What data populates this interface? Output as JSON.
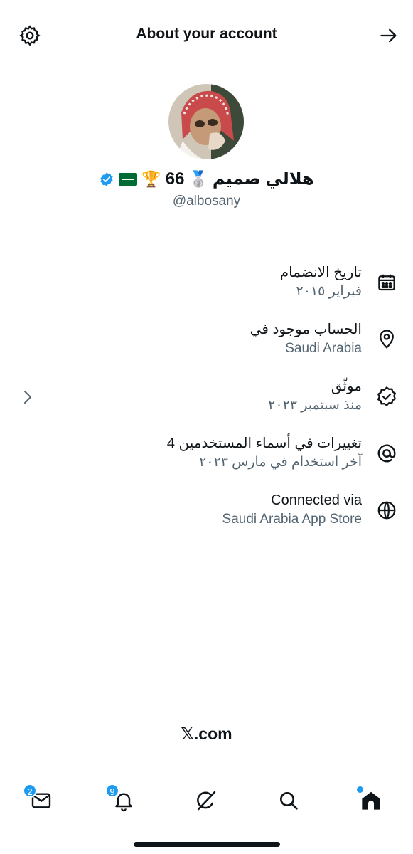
{
  "header": {
    "title": "About your account"
  },
  "profile": {
    "name": "هلالي صميم",
    "number": "66",
    "badges": [
      "🥈",
      "🏆"
    ],
    "handle": "@albosany",
    "verified_color": "#1d9bf0"
  },
  "info": [
    {
      "primary": "تاريخ الانضمام",
      "secondary": "فبراير ٢٠١٥",
      "icon": "calendar-icon"
    },
    {
      "primary": "الحساب موجود في",
      "secondary": "Saudi Arabia",
      "icon": "location-pin-icon"
    },
    {
      "primary": "موثّق",
      "secondary": "منذ سبتمبر ٢٠٢٣",
      "icon": "verified-check-icon"
    },
    {
      "primary": "4 تغييرات في أسماء المستخدمين",
      "secondary": "آخر استخدام في مارس ٢٠٢٣",
      "icon": "at-sign-icon"
    },
    {
      "primary": "Connected via",
      "secondary": "Saudi Arabia App Store",
      "icon": "globe-icon"
    }
  ],
  "footer": {
    "brand": "𝕏.com"
  },
  "tabbar": {
    "messages_badge": "2",
    "notifications_badge": "9"
  },
  "colors": {
    "accent": "#1d9bf0",
    "text": "#0f1419",
    "secondary_text": "#536471"
  }
}
